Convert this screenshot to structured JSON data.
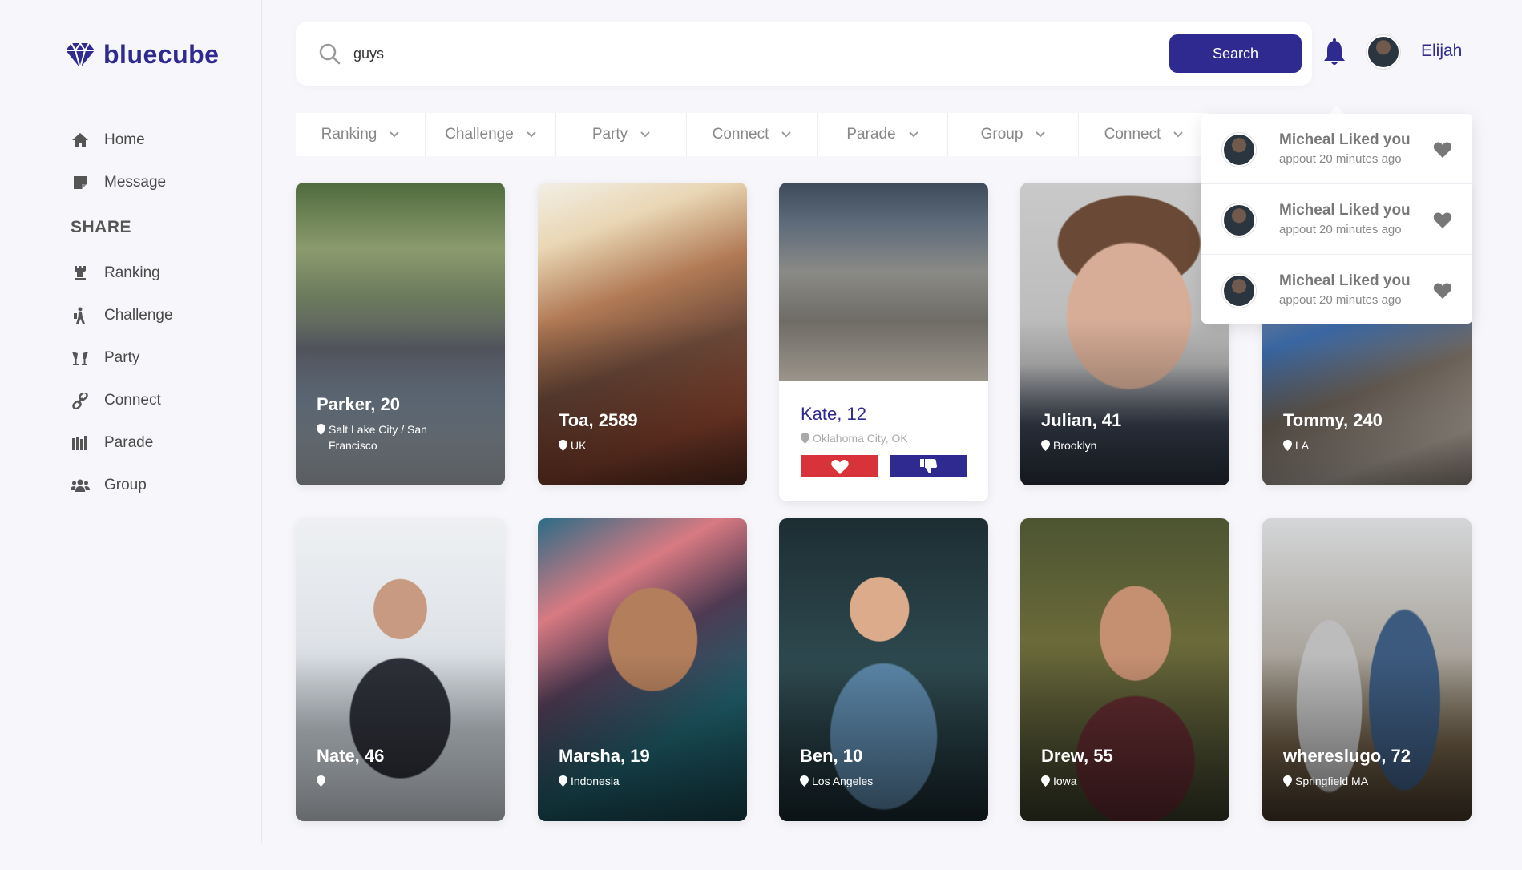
{
  "brand": {
    "name": "bluecube",
    "color": "#2e2a8f"
  },
  "sidebar": {
    "items_top": [
      {
        "label": "Home",
        "icon": "home-icon"
      },
      {
        "label": "Message",
        "icon": "message-icon"
      }
    ],
    "share_heading": "SHARE",
    "items_share": [
      {
        "label": "Ranking",
        "icon": "chess-rook-icon"
      },
      {
        "label": "Challenge",
        "icon": "hiking-icon"
      },
      {
        "label": "Party",
        "icon": "glasses-cheers-icon"
      },
      {
        "label": "Connect",
        "icon": "link-icon"
      },
      {
        "label": "Parade",
        "icon": "parade-icon"
      },
      {
        "label": "Group",
        "icon": "users-icon"
      }
    ]
  },
  "search": {
    "value": "guys",
    "placeholder": "",
    "button_label": "Search"
  },
  "header": {
    "user_name": "Elijah",
    "bell_icon": "bell-icon"
  },
  "filters": [
    "Ranking",
    "Challenge",
    "Party",
    "Connect",
    "Parade",
    "Group",
    "Connect"
  ],
  "notifications": [
    {
      "title": "Micheal Liked you",
      "time": "appout 20 minutes ago"
    },
    {
      "title": "Micheal Liked you",
      "time": "appout 20 minutes ago"
    },
    {
      "title": "Micheal Liked you",
      "time": "appout 20 minutes ago"
    }
  ],
  "cards": [
    {
      "name": "Parker, 20",
      "location": "Salt Lake City / San Francisco"
    },
    {
      "name": "Toa, 2589",
      "location": "UK"
    },
    {
      "name": "Kate, 12",
      "location": "Oklahoma City, OK"
    },
    {
      "name": "Julian, 41",
      "location": "Brooklyn"
    },
    {
      "name": "Tommy, 240",
      "location": "LA"
    },
    {
      "name": "Nate, 46",
      "location": ""
    },
    {
      "name": "Marsha, 19",
      "location": "Indonesia"
    },
    {
      "name": "Ben, 10",
      "location": "Los Angeles"
    },
    {
      "name": "Drew, 55",
      "location": "Iowa"
    },
    {
      "name": "whereslugo, 72",
      "location": "Springfield MA"
    }
  ],
  "colors": {
    "accent": "#2e2a8f",
    "like": "#d8333b",
    "background": "#f7f7fb"
  }
}
